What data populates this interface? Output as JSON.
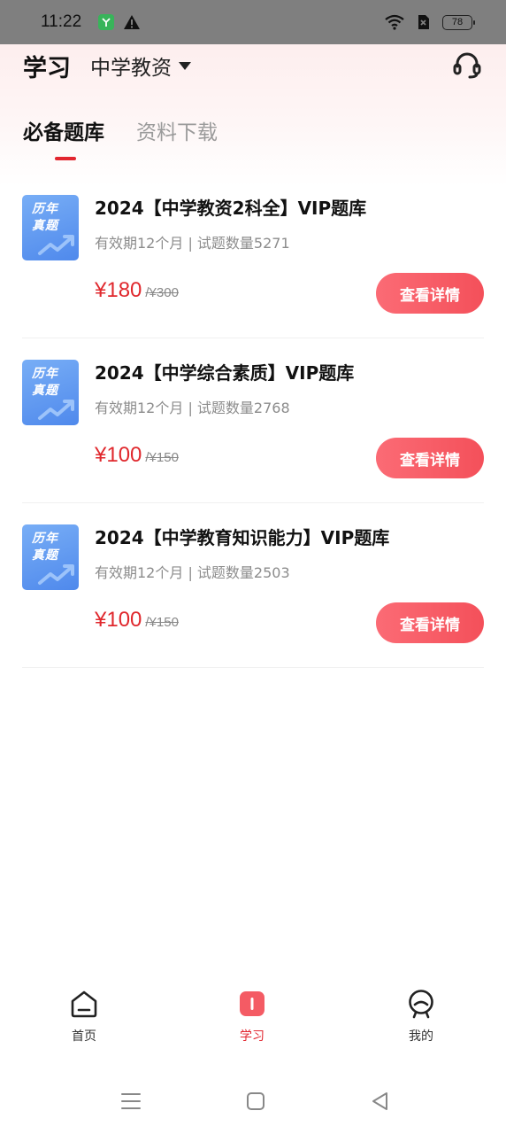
{
  "status_bar": {
    "time": "11:22",
    "battery": "78"
  },
  "header": {
    "title": "学习",
    "subject": "中学教资"
  },
  "tabs": [
    {
      "label": "必备题库",
      "active": true
    },
    {
      "label": "资料下载",
      "active": false
    }
  ],
  "thumb_text": [
    "历年",
    "真题"
  ],
  "products": [
    {
      "title": "2024【中学教资2科全】VIP题库",
      "meta": "有效期12个月 | 试题数量5271",
      "price": "¥180",
      "original_price": "/¥300",
      "button": "查看详情"
    },
    {
      "title": "2024【中学综合素质】VIP题库",
      "meta": "有效期12个月 | 试题数量2768",
      "price": "¥100",
      "original_price": "/¥150",
      "button": "查看详情"
    },
    {
      "title": "2024【中学教育知识能力】VIP题库",
      "meta": "有效期12个月 | 试题数量2503",
      "price": "¥100",
      "original_price": "/¥150",
      "button": "查看详情"
    }
  ],
  "bottom_nav": [
    {
      "label": "首页",
      "icon": "home-icon",
      "active": false
    },
    {
      "label": "学习",
      "icon": "book-icon",
      "active": true
    },
    {
      "label": "我的",
      "icon": "profile-icon",
      "active": false
    }
  ],
  "colors": {
    "accent": "#e2262f",
    "button": "#f4505a",
    "thumb": "#5b92ef"
  }
}
